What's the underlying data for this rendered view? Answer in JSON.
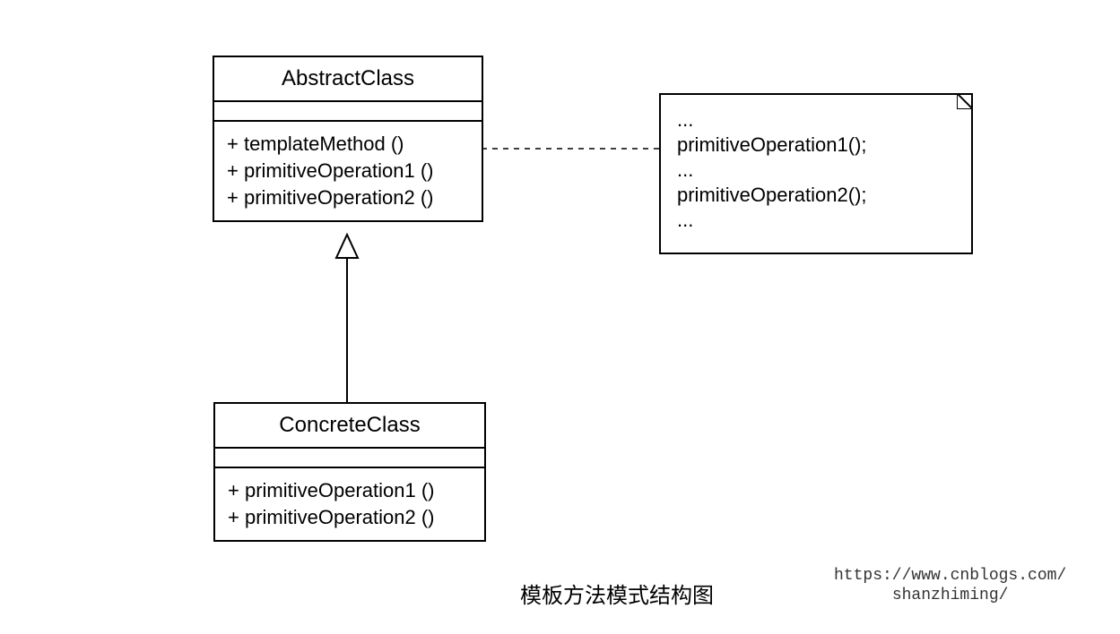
{
  "abstractClass": {
    "name": "AbstractClass",
    "method1": "+  templateMethod ()",
    "method2": "+  primitiveOperation1 ()",
    "method3": "+  primitiveOperation2 ()"
  },
  "concreteClass": {
    "name": "ConcreteClass",
    "method1": "+  primitiveOperation1 ()",
    "method2": "+  primitiveOperation2 ()"
  },
  "note": {
    "line1": "...",
    "line2": "primitiveOperation1();",
    "line3": "...",
    "line4": "primitiveOperation2();",
    "line5": "..."
  },
  "caption": "模板方法模式结构图",
  "watermark": "https://www.cnblogs.com/\nshanzhiming/"
}
